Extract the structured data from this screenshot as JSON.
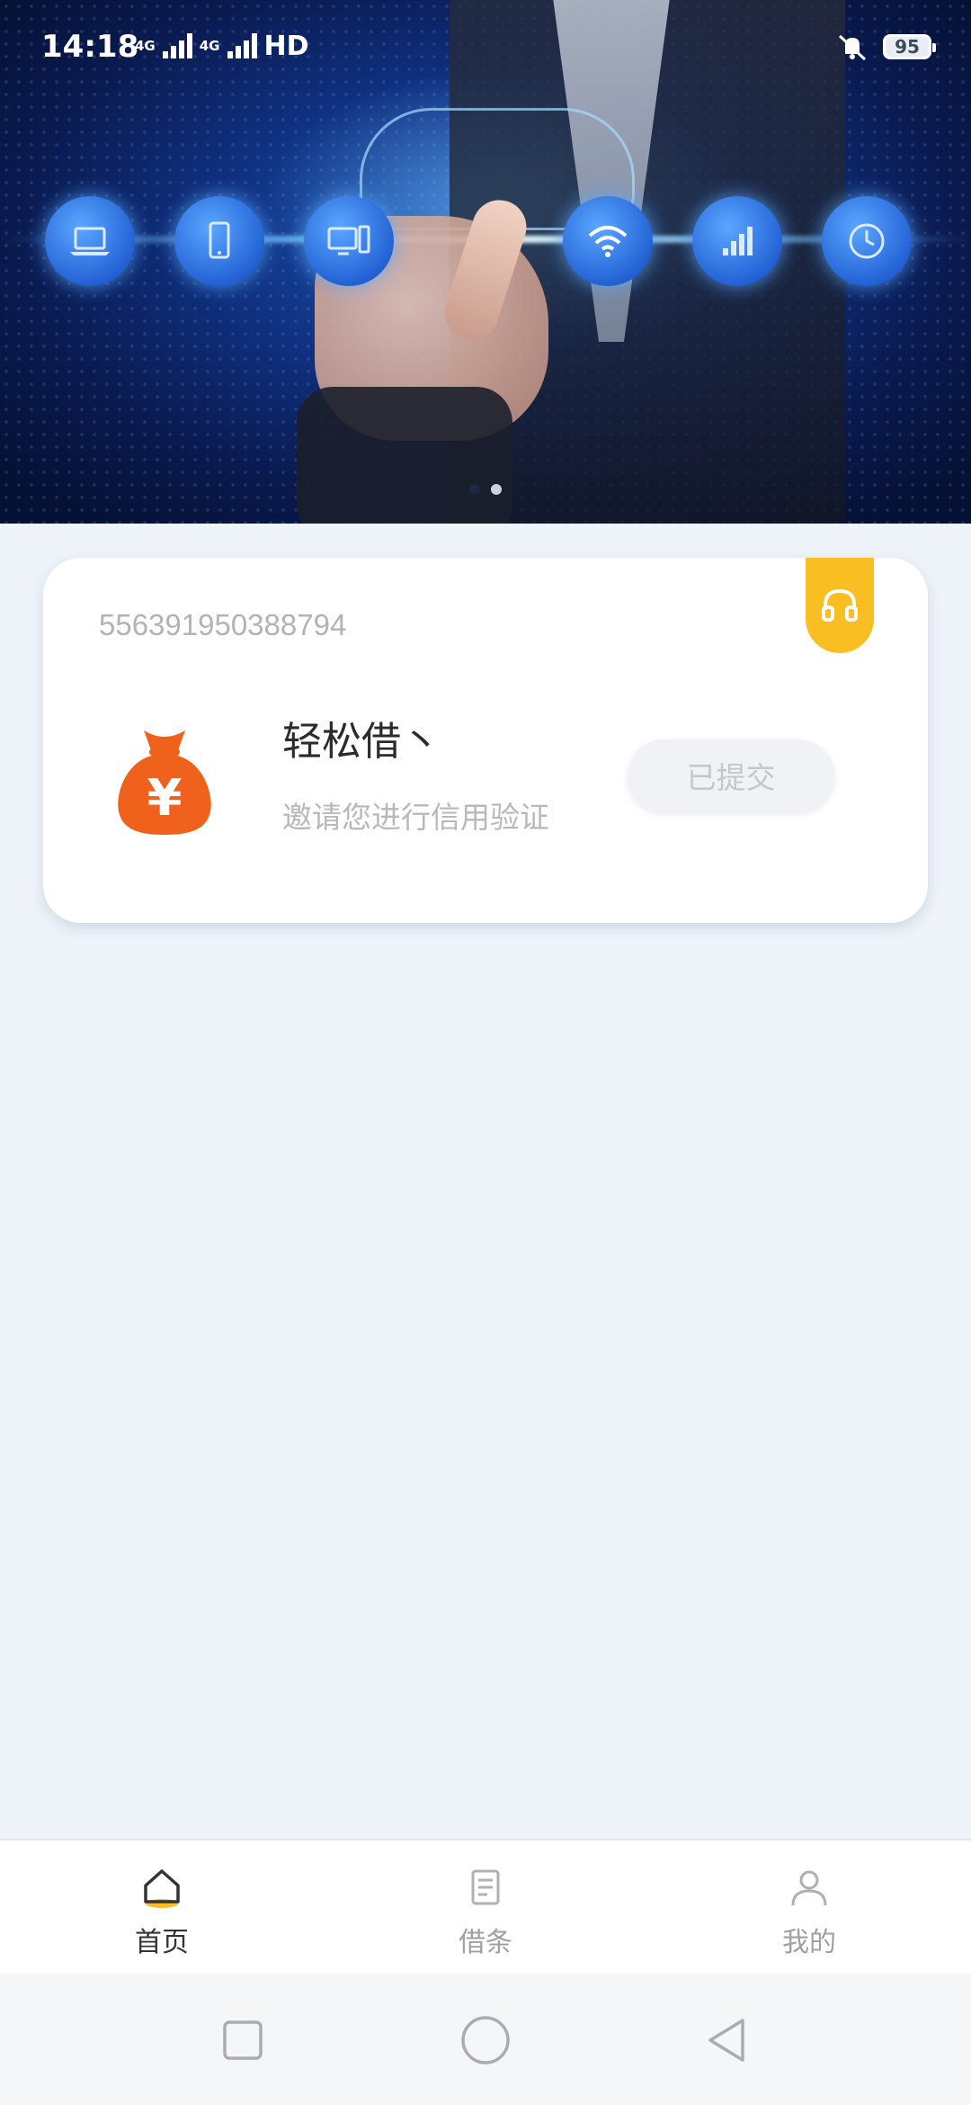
{
  "status_bar": {
    "time": "14:18",
    "network1": "4G",
    "network2": "4G",
    "hd": "HD",
    "battery": "95"
  },
  "banner": {
    "slide_count": 2,
    "active_slide": 2,
    "icons": [
      "laptop-icon",
      "phone-icon",
      "desktop-icon",
      "cloud-icon",
      "wifi-icon",
      "signal-icon",
      "clock-icon"
    ]
  },
  "card": {
    "id_number": "556391950388794",
    "app_name": "轻松借丶",
    "subtitle": "邀请您进行信用验证",
    "status_button": "已提交",
    "logo_symbol": "¥",
    "service_icon": "headset-icon"
  },
  "bottom_nav": {
    "items": [
      {
        "label": "首页",
        "icon": "home-icon",
        "active": true
      },
      {
        "label": "借条",
        "icon": "document-icon",
        "active": false
      },
      {
        "label": "我的",
        "icon": "user-icon",
        "active": false
      }
    ]
  },
  "system_nav": {
    "icons": [
      "recent-apps-icon",
      "home-circle-icon",
      "back-icon"
    ]
  },
  "colors": {
    "accent_yellow": "#f8be22",
    "logo_orange": "#f0621c",
    "background": "#eff4fa",
    "banner_blue": "#1d56b8"
  }
}
